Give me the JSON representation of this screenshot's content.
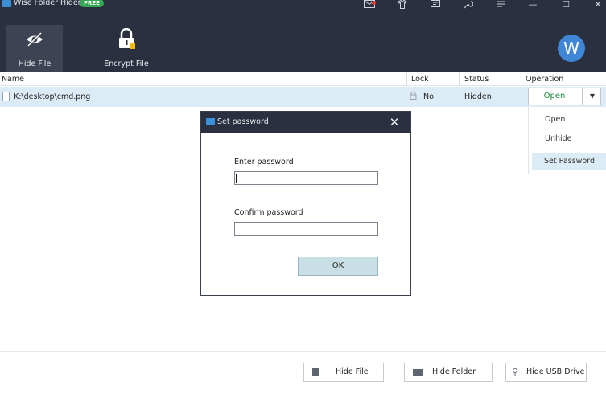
{
  "app": {
    "title": "Wise Folder Hider",
    "badge": "FREE",
    "window_controls": {
      "minimize": "—",
      "maximize": "☐",
      "close": "✕"
    },
    "toolbar_icons": [
      "mail-icon",
      "shirt-icon",
      "chat-icon",
      "wrench-icon",
      "menu-icon"
    ]
  },
  "tools": [
    {
      "label": "Hide File",
      "icon": "hide-eye-icon",
      "active": true
    },
    {
      "label": "Encrypt File",
      "icon": "lock-icon",
      "active": false
    }
  ],
  "avatar": {
    "letter": "W"
  },
  "table": {
    "headers": {
      "name": "Name",
      "lock": "Lock",
      "status": "Status",
      "operation": "Operation"
    },
    "row": {
      "name": "K:\\desktop\\cmd.png",
      "lock": "No",
      "status": "Hidden",
      "operation": "Open"
    }
  },
  "operation_menu": {
    "items": [
      "Open",
      "Unhide",
      "Set Password"
    ],
    "selected": "Set Password"
  },
  "dialog": {
    "title": "Set password",
    "close": "✕",
    "enter_label": "Enter password",
    "enter_value": "",
    "confirm_label": "Confirm password",
    "confirm_value": "",
    "ok_label": "OK"
  },
  "footer": {
    "hide_file": "Hide File",
    "hide_folder": "Hide Folder",
    "hide_usb": "Hide USB Drive"
  },
  "colors": {
    "header_bg": "#2b3040",
    "accent_green": "#1b8a3a",
    "row_highlight": "#dcecf6",
    "avatar": "#3f86d6"
  }
}
